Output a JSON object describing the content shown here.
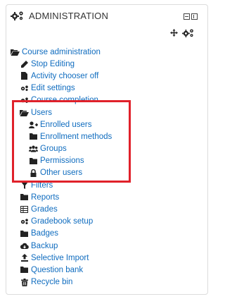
{
  "block": {
    "title": "ADMINISTRATION",
    "controls": {
      "minimize": "minimize-icon",
      "dock": "dock-icon"
    },
    "tools": {
      "move": "move-icon",
      "settings": "cog-icon"
    }
  },
  "tree": {
    "root_label": "Course administration",
    "items": [
      {
        "label": "Stop Editing",
        "icon": "pencil-icon"
      },
      {
        "label": "Activity chooser off",
        "icon": "file-icon"
      },
      {
        "label": "Edit settings",
        "icon": "cog-icon"
      },
      {
        "label": "Course completion",
        "icon": "cog-icon"
      }
    ],
    "users": {
      "label": "Users",
      "children": [
        {
          "label": "Enrolled users",
          "icon": "user-plus-icon"
        },
        {
          "label": "Enrollment methods",
          "icon": "folder-icon"
        },
        {
          "label": "Groups",
          "icon": "users-icon"
        },
        {
          "label": "Permissions",
          "icon": "folder-icon"
        },
        {
          "label": "Other users",
          "icon": "lock-icon"
        }
      ]
    },
    "after": [
      {
        "label": "Filters",
        "icon": "filter-icon"
      },
      {
        "label": "Reports",
        "icon": "folder-icon"
      },
      {
        "label": "Grades",
        "icon": "table-icon"
      },
      {
        "label": "Gradebook setup",
        "icon": "cog-icon"
      },
      {
        "label": "Badges",
        "icon": "folder-icon"
      },
      {
        "label": "Backup",
        "icon": "cloud-download-icon"
      },
      {
        "label": "Selective Import",
        "icon": "upload-icon"
      },
      {
        "label": "Question bank",
        "icon": "folder-icon"
      },
      {
        "label": "Recycle bin",
        "icon": "trash-icon"
      }
    ]
  },
  "colors": {
    "link": "#0f6cbf",
    "icon": "#222222",
    "highlight": "#e0212a"
  }
}
